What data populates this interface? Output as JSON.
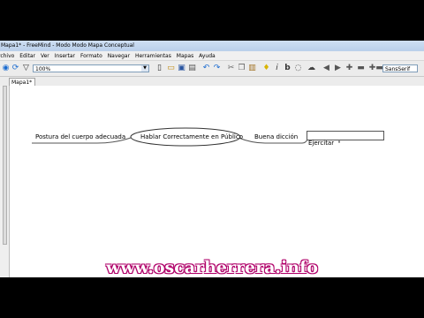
{
  "window": {
    "title": "Mapa1* - FreeMind - Modo Modo Mapa Conceptual"
  },
  "menu": [
    "rchivo",
    "Editar",
    "Ver",
    "Insertar",
    "Formato",
    "Navegar",
    "Herramientas",
    "Mapas",
    "Ayuda"
  ],
  "toolbar": {
    "zoom_value": "100%",
    "font_value": "SansSerif"
  },
  "tabs": [
    {
      "label": "Mapa1*"
    }
  ],
  "map": {
    "root": "Hablar Correctamente en Público",
    "left_child": "Postura del cuerpo adecuada",
    "right_child": "Buena dicción",
    "editing_node": "Ejercitar"
  },
  "watermark": "www.oscarherrera.info"
}
